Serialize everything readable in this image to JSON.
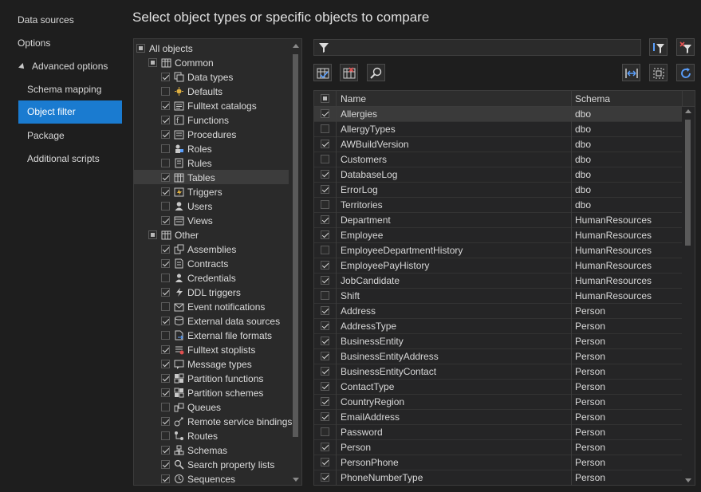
{
  "page": {
    "title": "Select object types or specific objects  to compare"
  },
  "nav": {
    "items": [
      {
        "label": "Data sources",
        "level": 0,
        "selected": false
      },
      {
        "label": "Options",
        "level": 0,
        "selected": false
      },
      {
        "label": "Advanced options",
        "level": 0,
        "selected": false,
        "expanded": true
      },
      {
        "label": "Schema mapping",
        "level": 1,
        "selected": false
      },
      {
        "label": "Object filter",
        "level": 1,
        "selected": true
      },
      {
        "label": "Package",
        "level": 1,
        "selected": false
      },
      {
        "label": "Additional scripts",
        "level": 1,
        "selected": false
      }
    ]
  },
  "tree": {
    "items": [
      {
        "label": "All objects",
        "level": 0,
        "state": "partial",
        "icon": ""
      },
      {
        "label": "Common",
        "level": 1,
        "state": "partial",
        "icon": "table-group-icon"
      },
      {
        "label": "Data types",
        "level": 2,
        "state": "checked",
        "icon": "data-type-icon"
      },
      {
        "label": "Defaults",
        "level": 2,
        "state": "unchecked",
        "icon": "default-icon"
      },
      {
        "label": "Fulltext catalogs",
        "level": 2,
        "state": "checked",
        "icon": "fulltext-catalog-icon"
      },
      {
        "label": "Functions",
        "level": 2,
        "state": "checked",
        "icon": "function-icon"
      },
      {
        "label": "Procedures",
        "level": 2,
        "state": "checked",
        "icon": "procedure-icon"
      },
      {
        "label": "Roles",
        "level": 2,
        "state": "unchecked",
        "icon": "role-icon"
      },
      {
        "label": "Rules",
        "level": 2,
        "state": "unchecked",
        "icon": "rule-icon"
      },
      {
        "label": "Tables",
        "level": 2,
        "state": "checked",
        "icon": "table-icon",
        "selected": true
      },
      {
        "label": "Triggers",
        "level": 2,
        "state": "checked",
        "icon": "trigger-icon"
      },
      {
        "label": "Users",
        "level": 2,
        "state": "unchecked",
        "icon": "user-icon"
      },
      {
        "label": "Views",
        "level": 2,
        "state": "checked",
        "icon": "view-icon"
      },
      {
        "label": "Other",
        "level": 1,
        "state": "partial",
        "icon": "table-group-icon"
      },
      {
        "label": "Assemblies",
        "level": 2,
        "state": "checked",
        "icon": "assembly-icon"
      },
      {
        "label": "Contracts",
        "level": 2,
        "state": "checked",
        "icon": "contract-icon"
      },
      {
        "label": "Credentials",
        "level": 2,
        "state": "unchecked",
        "icon": "credential-icon"
      },
      {
        "label": "DDL triggers",
        "level": 2,
        "state": "checked",
        "icon": "ddl-trigger-icon"
      },
      {
        "label": "Event notifications",
        "level": 2,
        "state": "unchecked",
        "icon": "event-notification-icon"
      },
      {
        "label": "External data sources",
        "level": 2,
        "state": "checked",
        "icon": "external-data-source-icon"
      },
      {
        "label": "External file formats",
        "level": 2,
        "state": "unchecked",
        "icon": "external-file-format-icon"
      },
      {
        "label": "Fulltext stoplists",
        "level": 2,
        "state": "checked",
        "icon": "fulltext-stoplist-icon"
      },
      {
        "label": "Message types",
        "level": 2,
        "state": "checked",
        "icon": "message-type-icon"
      },
      {
        "label": "Partition functions",
        "level": 2,
        "state": "checked",
        "icon": "partition-function-icon"
      },
      {
        "label": "Partition schemes",
        "level": 2,
        "state": "checked",
        "icon": "partition-scheme-icon"
      },
      {
        "label": "Queues",
        "level": 2,
        "state": "unchecked",
        "icon": "queue-icon"
      },
      {
        "label": "Remote service bindings",
        "level": 2,
        "state": "checked",
        "icon": "remote-binding-icon"
      },
      {
        "label": "Routes",
        "level": 2,
        "state": "unchecked",
        "icon": "route-icon"
      },
      {
        "label": "Schemas",
        "level": 2,
        "state": "checked",
        "icon": "schema-icon"
      },
      {
        "label": "Search property lists",
        "level": 2,
        "state": "checked",
        "icon": "search-property-icon"
      },
      {
        "label": "Sequences",
        "level": 2,
        "state": "checked",
        "icon": "sequence-icon"
      }
    ]
  },
  "filter": {
    "value": ""
  },
  "toolbar": {
    "left": [
      "check-all-icon",
      "uncheck-all-icon",
      "find-icon"
    ],
    "right": [
      "fit-columns-icon",
      "select-region-icon",
      "refresh-icon"
    ],
    "top_right": [
      "filter-options-icon",
      "clear-filter-icon"
    ]
  },
  "grid": {
    "columns": [
      "Name",
      "Schema"
    ],
    "rows": [
      {
        "checked": true,
        "name": "Allergies",
        "schema": "dbo",
        "selected": true
      },
      {
        "checked": false,
        "name": "AllergyTypes",
        "schema": "dbo"
      },
      {
        "checked": true,
        "name": "AWBuildVersion",
        "schema": "dbo"
      },
      {
        "checked": false,
        "name": "Customers",
        "schema": "dbo"
      },
      {
        "checked": true,
        "name": "DatabaseLog",
        "schema": "dbo"
      },
      {
        "checked": true,
        "name": "ErrorLog",
        "schema": "dbo"
      },
      {
        "checked": false,
        "name": "Territories",
        "schema": "dbo"
      },
      {
        "checked": true,
        "name": "Department",
        "schema": "HumanResources"
      },
      {
        "checked": true,
        "name": "Employee",
        "schema": "HumanResources"
      },
      {
        "checked": false,
        "name": "EmployeeDepartmentHistory",
        "schema": "HumanResources"
      },
      {
        "checked": true,
        "name": "EmployeePayHistory",
        "schema": "HumanResources"
      },
      {
        "checked": true,
        "name": "JobCandidate",
        "schema": "HumanResources"
      },
      {
        "checked": false,
        "name": "Shift",
        "schema": "HumanResources"
      },
      {
        "checked": true,
        "name": "Address",
        "schema": "Person"
      },
      {
        "checked": true,
        "name": "AddressType",
        "schema": "Person"
      },
      {
        "checked": true,
        "name": "BusinessEntity",
        "schema": "Person"
      },
      {
        "checked": true,
        "name": "BusinessEntityAddress",
        "schema": "Person"
      },
      {
        "checked": true,
        "name": "BusinessEntityContact",
        "schema": "Person"
      },
      {
        "checked": true,
        "name": "ContactType",
        "schema": "Person"
      },
      {
        "checked": true,
        "name": "CountryRegion",
        "schema": "Person"
      },
      {
        "checked": true,
        "name": "EmailAddress",
        "schema": "Person"
      },
      {
        "checked": false,
        "name": "Password",
        "schema": "Person"
      },
      {
        "checked": true,
        "name": "Person",
        "schema": "Person"
      },
      {
        "checked": true,
        "name": "PersonPhone",
        "schema": "Person"
      },
      {
        "checked": true,
        "name": "PhoneNumberType",
        "schema": "Person"
      }
    ]
  },
  "colors": {
    "accent": "#1a7bd0",
    "background": "#1e1e1e",
    "panel": "#2a2a2a"
  }
}
